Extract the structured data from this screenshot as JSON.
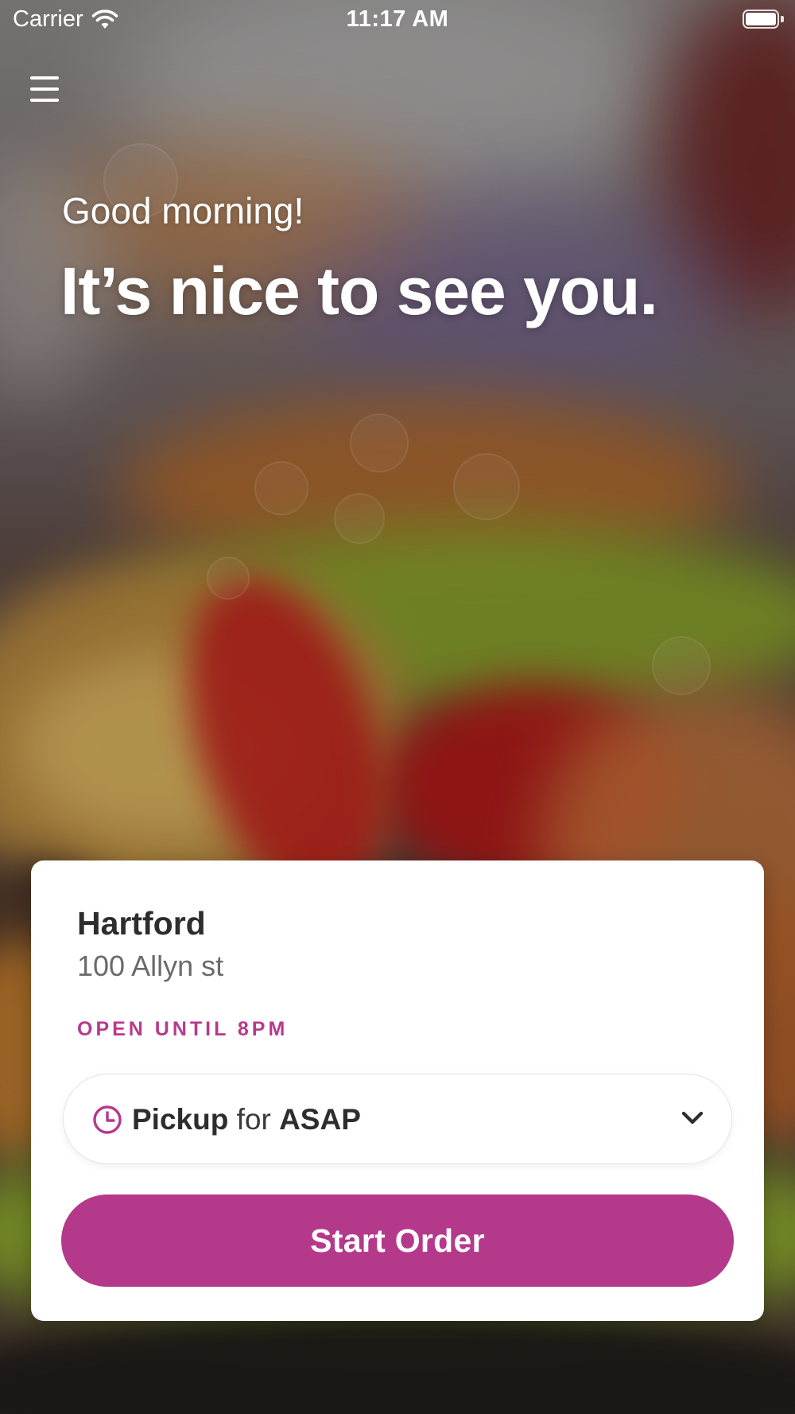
{
  "status_bar": {
    "carrier": "Carrier",
    "time": "11:17 AM",
    "wifi_icon": "wifi-icon",
    "battery_icon": "battery-icon",
    "battery_level": 1.0
  },
  "menu": {
    "icon": "hamburger-menu-icon"
  },
  "greeting": {
    "salutation": "Good morning!",
    "headline": "It’s nice to see you."
  },
  "location": {
    "name": "Hartford",
    "address": "100 Allyn st",
    "hours": "OPEN UNTIL 8PM"
  },
  "order_type": {
    "icon": "clock-icon",
    "mode": "Pickup",
    "connector": "for",
    "time": "ASAP",
    "chevron": "chevron-down-icon"
  },
  "actions": {
    "start_order_label": "Start Order"
  },
  "colors": {
    "accent": "#b5398b",
    "hours_text": "#b73a8d",
    "card_background": "#ffffff",
    "title_text": "#2d2d2d",
    "secondary_text": "#6a6a6a"
  }
}
